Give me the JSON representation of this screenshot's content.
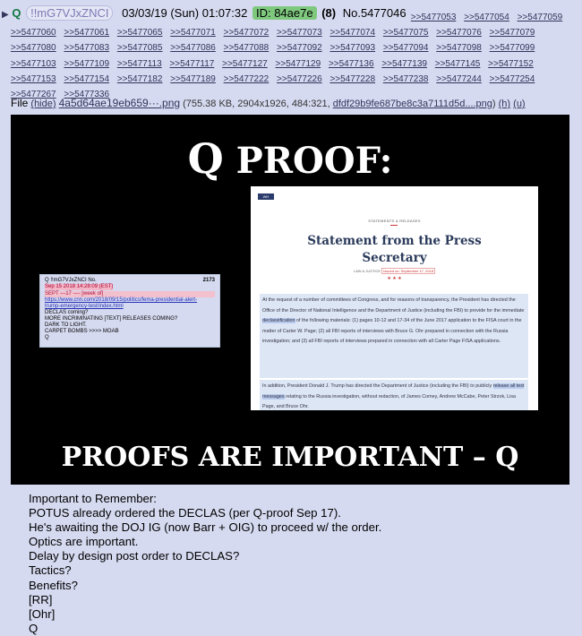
{
  "header": {
    "arrow": "▶",
    "name": "Q",
    "tripcode": "!!mG7VJxZNCI",
    "date": "03/03/19 (Sun) 01:07:32",
    "id": "ID: 84ae7e",
    "count": "(8)",
    "post_number": "No.5477046"
  },
  "backlinks": [
    ">>5477053",
    ">>5477054",
    ">>5477059",
    ">>5477060",
    ">>5477061",
    ">>5477065",
    ">>5477071",
    ">>5477072",
    ">>5477073",
    ">>5477074",
    ">>5477075",
    ">>5477076",
    ">>5477079",
    ">>5477080",
    ">>5477083",
    ">>5477085",
    ">>5477086",
    ">>5477088",
    ">>5477092",
    ">>5477093",
    ">>5477094",
    ">>5477098",
    ">>5477099",
    ">>5477103",
    ">>5477109",
    ">>5477113",
    ">>5477117",
    ">>5477127",
    ">>5477129",
    ">>5477136",
    ">>5477139",
    ">>5477145",
    ">>5477152",
    ">>5477153",
    ">>5477154",
    ">>5477182",
    ">>5477189",
    ">>5477222",
    ">>5477226",
    ">>5477228",
    ">>5477238",
    ">>5477244",
    ">>5477254",
    ">>5477267",
    ">>5477336"
  ],
  "file": {
    "label": "File",
    "hide": "(hide)",
    "name": "4a5d64ae19eb659···.png",
    "meta": "(755.38 KB, 2904x1926, 484:321,",
    "orig": "dfdf29b9fe687be8c3a7111d5d....png",
    "meta_end": ")",
    "h": "(h)",
    "u": "(u)"
  },
  "image": {
    "title_q": "Q",
    "title_rest": " PROOF:",
    "bottom": "PROOFS ARE IMPORTANT – Q",
    "doc": {
      "logo": "WH",
      "kicker": "STATEMENTS & RELEASES",
      "title_line1": "Statement from the Press",
      "title_line2": "Secretary",
      "category": "LAW & JUSTICE",
      "date": "Issued on: September 17, 2018",
      "stars": "★ ★ ★",
      "para1_a": "At the request of a number of committees of Congress, and for reasons of transparency, the President has directed the Office of the Director of National Intelligence and the Department of Justice (including the FBI) to provide for the immediate ",
      "para1_hl": "declassification",
      "para1_b": " of the following materials: (1) pages 10-12 and 17-34 of the June 2017 application to the FISA court in the matter of Carter W. Page; (2) all FBI reports of interviews with Bruce G. Ohr prepared in connection with the Russia investigation; and (3) all FBI reports of interviews prepared in connection with all Carter Page FISA applications.",
      "para2_a": "In addition, President Donald J. Trump has directed the Department of Justice (including the FBI) to publicly ",
      "para2_hl": "release all text messages",
      "para2_b": " relating to the Russia investigation, without redaction, of James Comey, Andrew McCabe, Peter Strzok, Lisa Page, and Bruce Ohr."
    },
    "card": {
      "header": "Q !!mG7VJxZNCI No.",
      "number": "2173",
      "date": "Sep 15 2018 14:28:09 (EST)",
      "lines": [
        "SEPT ---17 ---- [week of]",
        "https://www.cnn.com/2018/09/15/politics/fema-presidential-alert-",
        "trump-emergency-test/index.html",
        "DECLAS coming?",
        "MORE INCRIMINATING [TEXT] RELEASES COMING?",
        "DARK TO LIGHT.",
        "CARPET BOMBS >>>> MOAB",
        "Q"
      ]
    }
  },
  "comment": [
    "Important to Remember:",
    "POTUS already ordered the DECLAS (per Q-proof Sep 17).",
    "He's awaiting the DOJ IG (now Barr + OIG) to proceed w/ the order.",
    "Optics are important.",
    "Delay by design post order to DECLAS?",
    "Tactics?",
    "Benefits?",
    "[RR]",
    "[Ohr]",
    "Q"
  ]
}
